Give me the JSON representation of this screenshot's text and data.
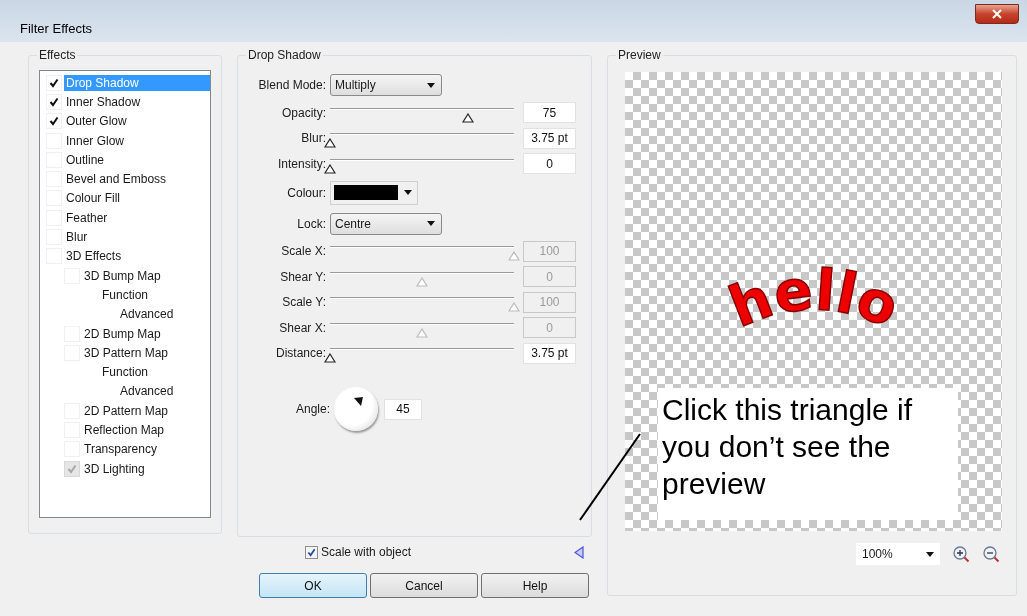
{
  "window": {
    "title": "Filter Effects"
  },
  "effects": {
    "title": "Effects",
    "items": [
      {
        "label": "Drop Shadow",
        "kind": "check",
        "checked": true,
        "selected": true,
        "disabled": false
      },
      {
        "label": "Inner Shadow",
        "kind": "check",
        "checked": true,
        "selected": false,
        "disabled": false
      },
      {
        "label": "Outer Glow",
        "kind": "check",
        "checked": true,
        "selected": false,
        "disabled": false
      },
      {
        "label": "Inner Glow",
        "kind": "check",
        "checked": false,
        "selected": false,
        "disabled": false
      },
      {
        "label": "Outline",
        "kind": "check",
        "checked": false,
        "selected": false,
        "disabled": false
      },
      {
        "label": "Bevel and Emboss",
        "kind": "check",
        "checked": false,
        "selected": false,
        "disabled": false
      },
      {
        "label": "Colour Fill",
        "kind": "check",
        "checked": false,
        "selected": false,
        "disabled": false
      },
      {
        "label": "Feather",
        "kind": "check",
        "checked": false,
        "selected": false,
        "disabled": false
      },
      {
        "label": "Blur",
        "kind": "check",
        "checked": false,
        "selected": false,
        "disabled": false
      },
      {
        "label": "3D Effects",
        "kind": "check",
        "checked": false,
        "selected": false,
        "disabled": false,
        "children": [
          {
            "label": "3D Bump Map",
            "kind": "check",
            "checked": false,
            "selected": false,
            "disabled": false,
            "children": [
              {
                "label": "Function",
                "kind": "plain",
                "selected": false,
                "children": [
                  {
                    "label": "Advanced",
                    "kind": "plain",
                    "selected": false
                  }
                ]
              }
            ]
          },
          {
            "label": "2D Bump Map",
            "kind": "check",
            "checked": false,
            "selected": false,
            "disabled": false
          },
          {
            "label": "3D Pattern Map",
            "kind": "check",
            "checked": false,
            "selected": false,
            "disabled": false,
            "children": [
              {
                "label": "Function",
                "kind": "plain",
                "selected": false,
                "children": [
                  {
                    "label": "Advanced",
                    "kind": "plain",
                    "selected": false
                  }
                ]
              }
            ]
          },
          {
            "label": "2D Pattern Map",
            "kind": "check",
            "checked": false,
            "selected": false,
            "disabled": false
          },
          {
            "label": "Reflection Map",
            "kind": "check",
            "checked": false,
            "selected": false,
            "disabled": false
          },
          {
            "label": "Transparency",
            "kind": "check",
            "checked": false,
            "selected": false,
            "disabled": false
          },
          {
            "label": "3D Lighting",
            "kind": "check",
            "checked": true,
            "selected": false,
            "disabled": true
          }
        ]
      }
    ]
  },
  "settings": {
    "title": "Drop Shadow",
    "controls": [
      {
        "kind": "dropdown",
        "label": "Blend Mode:",
        "value": "Multiply"
      },
      {
        "kind": "slider",
        "label": "Opacity:",
        "level": 0.75,
        "value": "75",
        "disabled": false
      },
      {
        "kind": "slider",
        "label": "Blur:",
        "level": 0,
        "value": "3.75 pt",
        "disabled": false
      },
      {
        "kind": "slider",
        "label": "Intensity:",
        "level": 0,
        "value": "0",
        "disabled": false
      },
      {
        "kind": "color",
        "label": "Colour:",
        "color": "#000000"
      },
      {
        "kind": "dropdown",
        "label": "Lock:",
        "value": "Centre"
      },
      {
        "kind": "slider",
        "label": "Scale X:",
        "level": 1,
        "value": "100",
        "disabled": true
      },
      {
        "kind": "slider",
        "label": "Shear Y:",
        "level": 0.5,
        "value": "0",
        "disabled": true
      },
      {
        "kind": "slider",
        "label": "Scale Y:",
        "level": 1,
        "value": "100",
        "disabled": true
      },
      {
        "kind": "slider",
        "label": "Shear X:",
        "level": 0.5,
        "value": "0",
        "disabled": true
      },
      {
        "kind": "slider",
        "label": "Distance:",
        "level": 0,
        "value": "3.75 pt",
        "disabled": false
      },
      {
        "kind": "angle",
        "label": "Angle:",
        "value": "45"
      }
    ]
  },
  "scale_with_object": {
    "label": "Scale with object",
    "checked": true
  },
  "buttons": [
    {
      "label": "OK",
      "default": true
    },
    {
      "label": "Cancel",
      "default": false
    },
    {
      "label": "Help",
      "default": false
    }
  ],
  "preview": {
    "title": "Preview",
    "artwork_text": "hello",
    "zoom": "100%"
  },
  "annotation": {
    "text": "Click this triangle if you don’t see the preview"
  }
}
